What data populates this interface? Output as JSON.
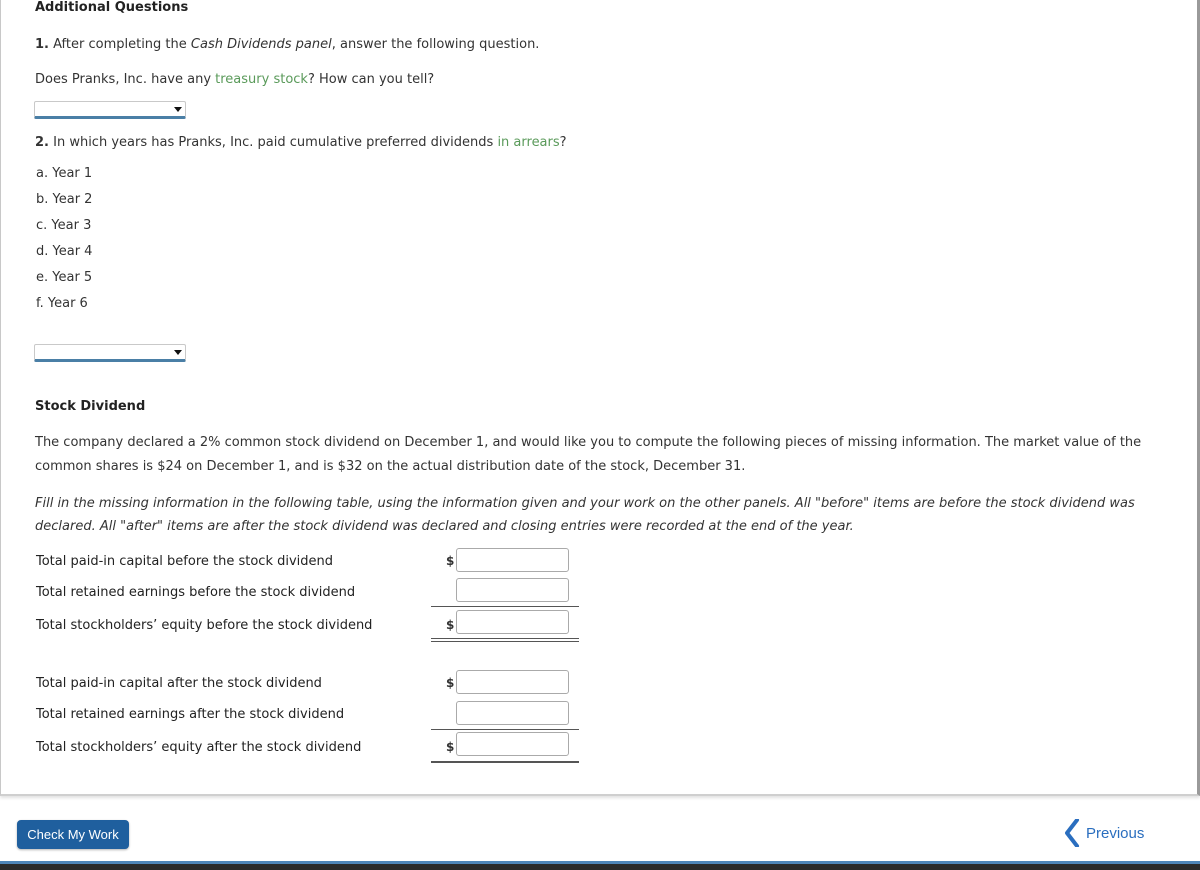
{
  "section_title": "Additional Questions",
  "q1": {
    "number": "1.",
    "text_pre": " After completing the ",
    "text_italic": "Cash Dividends panel",
    "text_post": ", answer the following question.",
    "question_pre": "Does Pranks, Inc. have any ",
    "question_link": "treasury stock",
    "question_post": "? How can you tell?",
    "select_value": ""
  },
  "q2": {
    "number": "2.",
    "text_pre": " In which years has Pranks, Inc. paid cumulative preferred dividends ",
    "text_link": "in arrears",
    "text_post": "?",
    "options": [
      "a. Year 1",
      "b. Year 2",
      "c. Year 3",
      "d. Year 4",
      "e. Year 5",
      "f.  Year 6"
    ],
    "select_value": ""
  },
  "stock_dividend": {
    "title": "Stock Dividend",
    "para1_line1": "The company declared a 2% common stock dividend on December 1, and would like you to compute the following pieces of missing information. The market value of the",
    "para1_line2": "common shares is $24 on December 1, and is $32 on the actual distribution date of the stock, December 31.",
    "para2_line1": "Fill in the missing information in the following table, using the information given and your work on the other panels. All \"before\" items are before the stock dividend was",
    "para2_line2": "declared. All \"after\" items are after the stock dividend was declared and closing entries were recorded at the end of the year.",
    "currency_symbol": "$",
    "rows": [
      {
        "label": "Total paid-in capital before the stock dividend",
        "value": ""
      },
      {
        "label": "Total retained earnings before the stock dividend",
        "value": ""
      },
      {
        "label": "Total stockholders’ equity before the stock dividend",
        "value": ""
      },
      {
        "label": "Total paid-in capital after the stock dividend",
        "value": ""
      },
      {
        "label": "Total retained earnings after the stock dividend",
        "value": ""
      },
      {
        "label": "Total stockholders’ equity after the stock dividend",
        "value": ""
      }
    ]
  },
  "footer": {
    "check_button": "Check My Work",
    "previous_link": "Previous",
    "accent_color": "#1f5f9e",
    "link_color": "#2a6ebf"
  }
}
